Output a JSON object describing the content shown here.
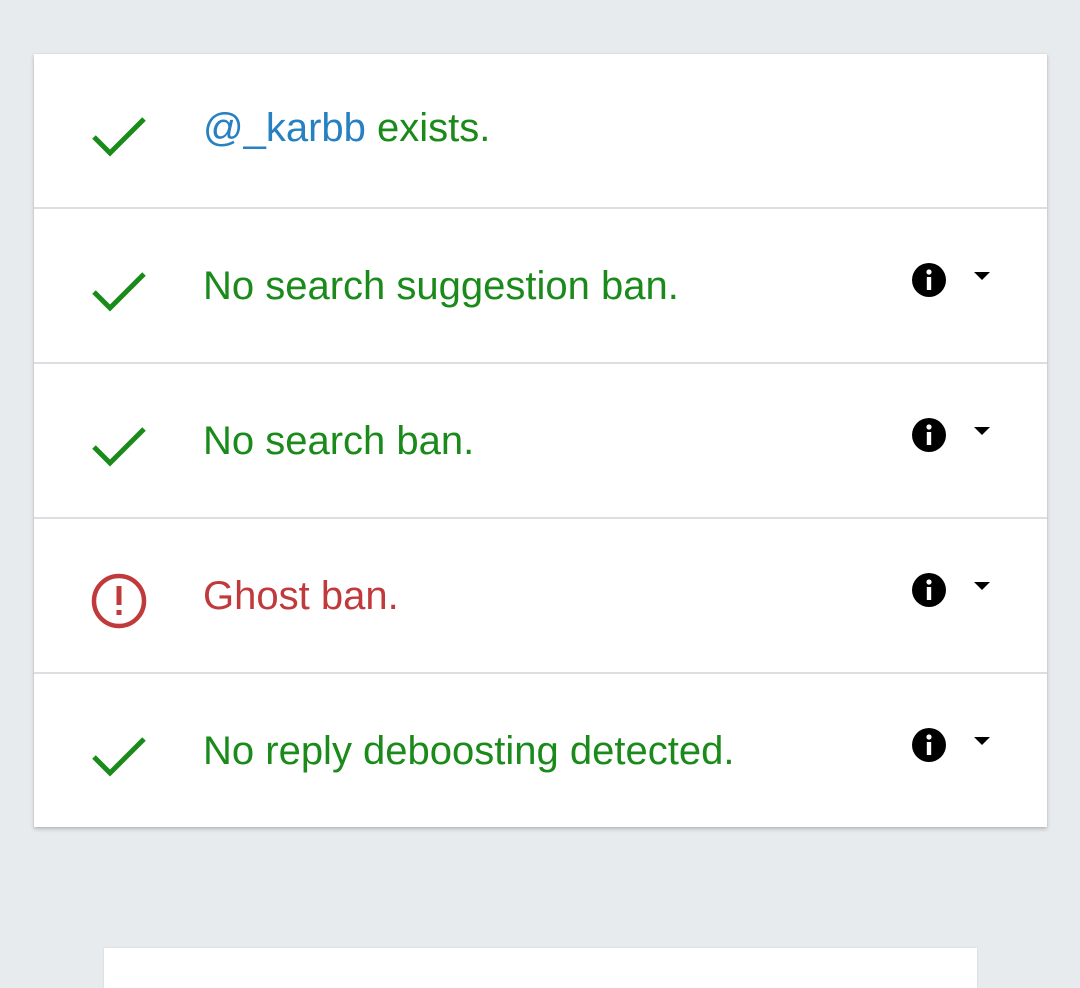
{
  "colors": {
    "ok": "#1a8a1a",
    "bad": "#c0393b",
    "handle": "#2680c2",
    "background": "#e8ebee"
  },
  "results": {
    "exists": {
      "handle": "@_karbb",
      "text": " exists.",
      "status": "ok",
      "icon": "check-icon"
    },
    "rows": [
      {
        "text": "No search suggestion ban.",
        "status": "ok",
        "icon": "check-icon"
      },
      {
        "text": "No search ban.",
        "status": "ok",
        "icon": "check-icon"
      },
      {
        "text": "Ghost ban.",
        "status": "bad",
        "icon": "alert-circle-icon"
      },
      {
        "text": "No reply deboosting detected.",
        "status": "ok",
        "icon": "check-icon"
      }
    ]
  }
}
